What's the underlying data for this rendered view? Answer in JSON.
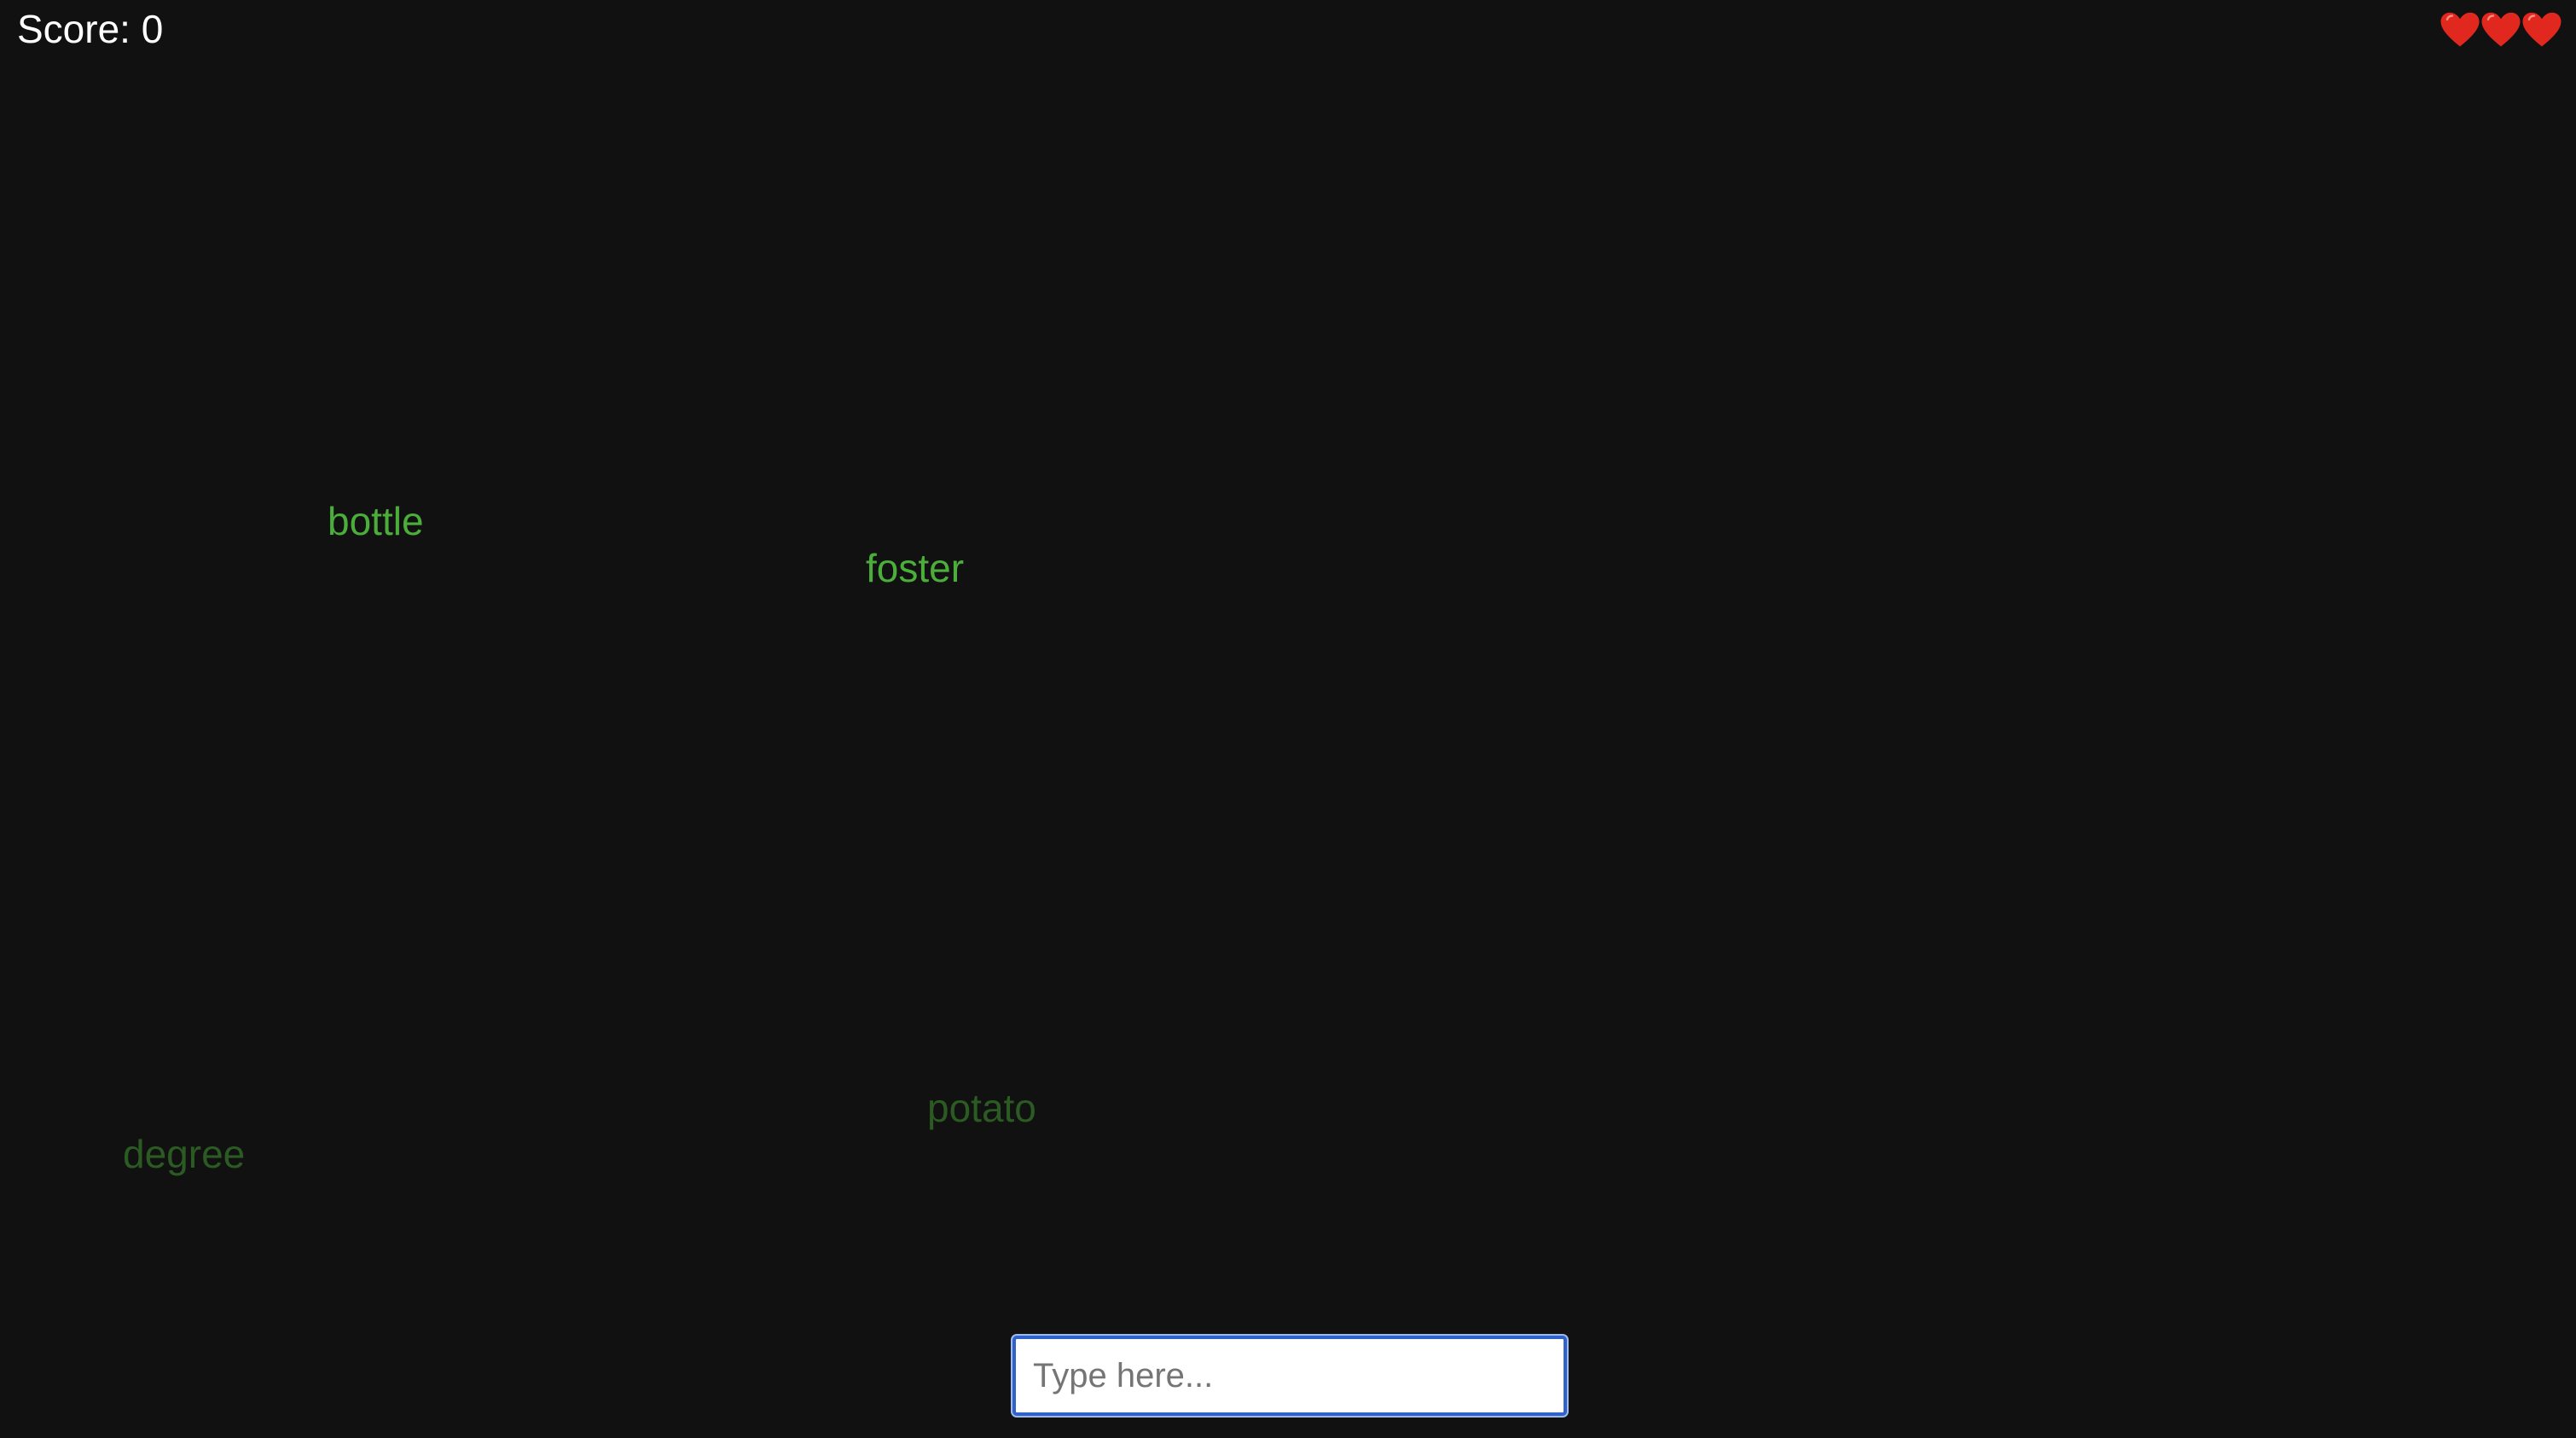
{
  "hud": {
    "score_label": "Score: 0",
    "lives": 3,
    "heart_icon": "heart-icon",
    "heart_color": "#e0281e"
  },
  "words": [
    {
      "text": "bottle",
      "color": "#4cae3a"
    },
    {
      "text": "foster",
      "color": "#4cae3a"
    },
    {
      "text": "potato",
      "color": "#2b5a22"
    },
    {
      "text": "degree",
      "color": "#2b5a22"
    }
  ],
  "input": {
    "placeholder": "Type here...",
    "value": ""
  },
  "colors": {
    "background": "#111111",
    "input_border": "#2f63c9"
  }
}
